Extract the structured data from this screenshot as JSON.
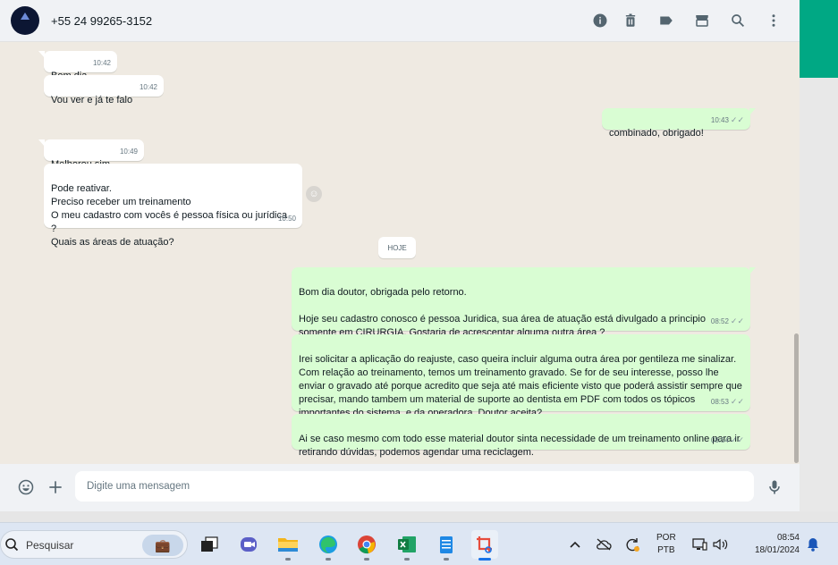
{
  "header": {
    "contact": "+55 24 99265-3152",
    "icons": [
      "info-icon",
      "trash-icon",
      "label-icon",
      "store-icon",
      "search-icon",
      "menu-icon"
    ]
  },
  "messages": [
    {
      "dir": "in",
      "text": "Bom dia",
      "time": "10:42"
    },
    {
      "dir": "in",
      "text": "Vou ver e já te falo",
      "time": "10:42"
    },
    {
      "dir": "out",
      "text": "combinado, obrigado!",
      "time": "10:43"
    },
    {
      "dir": "in",
      "text": "Melhorou sim.",
      "time": "10:49"
    },
    {
      "dir": "in",
      "text": "Pode reativar.\nPreciso receber um treinamento\nO meu cadastro com vocês é pessoa física ou jurídica ?\nQuais as áreas de atuação?",
      "time": "10:50"
    },
    {
      "dir": "out",
      "text": "Bom dia doutor, obrigada pelo retorno.\n\nHoje seu cadastro conosco é pessoa Juridica, sua área de atuação está divulgado a principio somente em CIRURGIA. Gostaria de acrescentar alguma outra área ?",
      "time": "08:52"
    },
    {
      "dir": "out",
      "text": "Irei solicitar a aplicação do reajuste, caso queira incluir alguma outra área por gentileza me sinalizar. Com relação ao treinamento, temos um treinamento gravado. Se for de seu interesse, posso lhe enviar o gravado até porque acredito que seja até mais eficiente visto que poderá assistir sempre que precisar, mando tambem um  material de suporte ao dentista em PDF com todos os tópicos importantes do sistema, e da operadora. Doutor aceita?",
      "time": "08:53"
    },
    {
      "dir": "out",
      "text": "Ai se caso mesmo com todo esse material doutor sinta necessidade de um treinamento online para ir retirando dúvidas, podemos agendar uma reciclagem.",
      "time": "08:54"
    }
  ],
  "day_divider": "HOJE",
  "composer": {
    "placeholder": "Digite uma mensagem"
  },
  "taskbar": {
    "search_label": "Pesquisar",
    "apps": [
      "briefcase-app",
      "task-view",
      "teams",
      "file-explorer",
      "edge",
      "chrome",
      "excel",
      "notepad",
      "snipping-tool"
    ],
    "lang_line1": "POR",
    "lang_line2": "PTB",
    "time": "08:54",
    "date": "18/01/2024"
  },
  "colors": {
    "chat_bg": "#efeae2",
    "incoming_bubble": "#ffffff",
    "outgoing_bubble": "#d9fdd3",
    "accent": "#00a884"
  }
}
